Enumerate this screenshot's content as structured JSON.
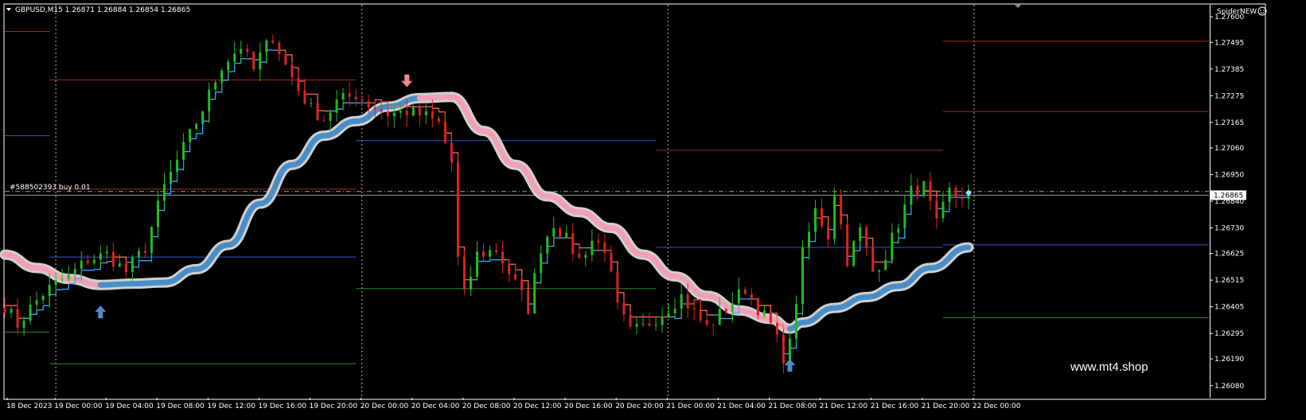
{
  "header": {
    "symbol_info": "GBPUSD,M15  1.26871 1.26884 1.26854 1.26865",
    "indicator_name": "SpiderNEW",
    "order_label": "#588502393 buy 0.01",
    "watermark": "www.mt4.shop"
  },
  "colors": {
    "background": "#000000",
    "bull_candle": "#22bb22",
    "bear_candle": "#dd2222",
    "stop_line_up": "#33aaff",
    "stop_line_down": "#ff6655",
    "band_outer": "#d0d0d0",
    "band_up": "#4a8ec8",
    "band_down": "#f2a0b4",
    "arrow_up": "#4a8ec8",
    "arrow_down": "#f08a8a",
    "order_line": "#66cc66",
    "price_tag": "#ffffff"
  },
  "chart_data": {
    "type": "candlestick",
    "instrument": "GBPUSD",
    "timeframe": "M15",
    "ohlc_last": {
      "open": 1.26871,
      "high": 1.26884,
      "low": 1.26854,
      "close": 1.26865
    },
    "ylim": [
      1.2603,
      1.2765
    ],
    "y_ticks": [
      "1.27600",
      "1.27495",
      "1.27385",
      "1.27275",
      "1.27165",
      "1.27060",
      "1.26950",
      "1.26840",
      "1.26730",
      "1.26625",
      "1.26515",
      "1.26405",
      "1.26295",
      "1.26190",
      "1.26080"
    ],
    "current_price_label": "1.26865",
    "current_price": 1.26865,
    "order_price": 1.2688,
    "x_ticks": [
      "18 Dec 2023",
      "19 Dec 00:00",
      "19 Dec 04:00",
      "19 Dec 08:00",
      "19 Dec 12:00",
      "19 Dec 16:00",
      "19 Dec 20:00",
      "20 Dec 00:00",
      "20 Dec 04:00",
      "20 Dec 08:00",
      "20 Dec 12:00",
      "20 Dec 16:00",
      "20 Dec 20:00",
      "21 Dec 00:00",
      "21 Dec 04:00",
      "21 Dec 08:00",
      "21 Dec 12:00",
      "21 Dec 16:00",
      "21 Dec 20:00",
      "22 Dec 00:00"
    ],
    "day_separators_at": [
      "19 Dec 00:00",
      "20 Dec 00:00",
      "21 Dec 00:00",
      "22 Dec 00:00"
    ],
    "price_path": [
      [
        0,
        1.2641
      ],
      [
        2,
        1.2633
      ],
      [
        4,
        1.264
      ],
      [
        6,
        1.2646
      ],
      [
        8,
        1.265
      ],
      [
        10,
        1.2653
      ],
      [
        13,
        1.266
      ],
      [
        16,
        1.2662
      ],
      [
        19,
        1.2655
      ],
      [
        22,
        1.2665
      ],
      [
        25,
        1.269
      ],
      [
        28,
        1.2706
      ],
      [
        31,
        1.2722
      ],
      [
        34,
        1.274
      ],
      [
        37,
        1.2748
      ],
      [
        39,
        1.2738
      ],
      [
        40,
        1.2744
      ],
      [
        42,
        1.2752
      ],
      [
        44,
        1.274
      ],
      [
        46,
        1.273
      ],
      [
        48,
        1.2722
      ],
      [
        50,
        1.2718
      ],
      [
        52,
        1.2725
      ],
      [
        55,
        1.2728
      ],
      [
        57,
        1.2724
      ],
      [
        60,
        1.272
      ],
      [
        63,
        1.2721
      ],
      [
        66,
        1.2719
      ],
      [
        68,
        1.2716
      ],
      [
        70,
        1.27
      ],
      [
        71,
        1.266
      ],
      [
        72,
        1.2645
      ],
      [
        74,
        1.2662
      ],
      [
        77,
        1.2664
      ],
      [
        80,
        1.265
      ],
      [
        82,
        1.264
      ],
      [
        84,
        1.2665
      ],
      [
        86,
        1.2675
      ],
      [
        88,
        1.2668
      ],
      [
        90,
        1.266
      ],
      [
        92,
        1.2668
      ],
      [
        94,
        1.2665
      ],
      [
        96,
        1.264
      ],
      [
        98,
        1.263
      ],
      [
        100,
        1.2632
      ],
      [
        103,
        1.2638
      ],
      [
        106,
        1.2645
      ],
      [
        108,
        1.2638
      ],
      [
        110,
        1.2632
      ],
      [
        113,
        1.264
      ],
      [
        116,
        1.2648
      ],
      [
        118,
        1.264
      ],
      [
        120,
        1.2633
      ],
      [
        122,
        1.262
      ],
      [
        123,
        1.2625
      ],
      [
        125,
        1.2662
      ],
      [
        127,
        1.268
      ],
      [
        129,
        1.267
      ],
      [
        130,
        1.2688
      ],
      [
        132,
        1.266
      ],
      [
        134,
        1.2672
      ],
      [
        136,
        1.2655
      ],
      [
        138,
        1.2662
      ],
      [
        140,
        1.2675
      ],
      [
        142,
        1.2688
      ],
      [
        144,
        1.269
      ],
      [
        146,
        1.2674
      ],
      [
        148,
        1.2688
      ],
      [
        149,
        1.2686
      ],
      [
        151,
        1.2687
      ]
    ],
    "signal_band": {
      "points": [
        [
          0,
          1.2662,
          "down"
        ],
        [
          5,
          1.26565,
          "down"
        ],
        [
          10,
          1.2652,
          "down"
        ],
        [
          15,
          1.26495,
          "up"
        ],
        [
          20,
          1.265,
          "up"
        ],
        [
          25,
          1.26505,
          "up"
        ],
        [
          30,
          1.2656,
          "up"
        ],
        [
          35,
          1.2666,
          "up"
        ],
        [
          40,
          1.2683,
          "up"
        ],
        [
          45,
          1.2699,
          "up"
        ],
        [
          50,
          1.2711,
          "up"
        ],
        [
          55,
          1.2717,
          "up"
        ],
        [
          60,
          1.2723,
          "up"
        ],
        [
          65,
          1.27265,
          "down"
        ],
        [
          70,
          1.2727,
          "down"
        ],
        [
          75,
          1.2713,
          "down"
        ],
        [
          80,
          1.2699,
          "down"
        ],
        [
          85,
          1.2686,
          "down"
        ],
        [
          90,
          1.26795,
          "down"
        ],
        [
          95,
          1.2673,
          "down"
        ],
        [
          100,
          1.2662,
          "down"
        ],
        [
          105,
          1.2653,
          "down"
        ],
        [
          110,
          1.2645,
          "down"
        ],
        [
          115,
          1.2639,
          "down"
        ],
        [
          120,
          1.26355,
          "down"
        ],
        [
          123,
          1.26315,
          "up"
        ],
        [
          125,
          1.2634,
          "up"
        ],
        [
          130,
          1.264,
          "up"
        ],
        [
          135,
          1.26445,
          "up"
        ],
        [
          140,
          1.2649,
          "up"
        ],
        [
          145,
          1.26565,
          "up"
        ],
        [
          151,
          1.2665,
          "up"
        ]
      ]
    },
    "signal_arrows": [
      {
        "bar": 15,
        "dir": "buy",
        "price": 1.2641
      },
      {
        "bar": 63,
        "dir": "sell",
        "price": 1.2731
      },
      {
        "bar": 123,
        "dir": "buy",
        "price": 1.2619
      }
    ],
    "pivot_levels": [
      {
        "from": 0,
        "to": 7,
        "price": 1.2754,
        "kind": "r"
      },
      {
        "from": 0,
        "to": 7,
        "price": 1.2711,
        "kind": "p"
      },
      {
        "from": 0,
        "to": 7,
        "price": 1.263,
        "kind": "s"
      },
      {
        "from": 7,
        "to": 55,
        "price": 1.2734,
        "kind": "r"
      },
      {
        "from": 7,
        "to": 55,
        "price": 1.2689,
        "kind": "r"
      },
      {
        "from": 7,
        "to": 55,
        "price": 1.2661,
        "kind": "p"
      },
      {
        "from": 7,
        "to": 55,
        "price": 1.2617,
        "kind": "s"
      },
      {
        "from": 55,
        "to": 102,
        "price": 1.2709,
        "kind": "p"
      },
      {
        "from": 55,
        "to": 102,
        "price": 1.2648,
        "kind": "s"
      },
      {
        "from": 102,
        "to": 147,
        "price": 1.2705,
        "kind": "r"
      },
      {
        "from": 102,
        "to": 147,
        "price": 1.2665,
        "kind": "p"
      },
      {
        "from": 147,
        "to": 200,
        "price": 1.275,
        "kind": "r"
      },
      {
        "from": 147,
        "to": 200,
        "price": 1.2721,
        "kind": "r"
      },
      {
        "from": 147,
        "to": 200,
        "price": 1.2666,
        "kind": "p"
      },
      {
        "from": 147,
        "to": 200,
        "price": 1.2636,
        "kind": "s"
      }
    ]
  }
}
